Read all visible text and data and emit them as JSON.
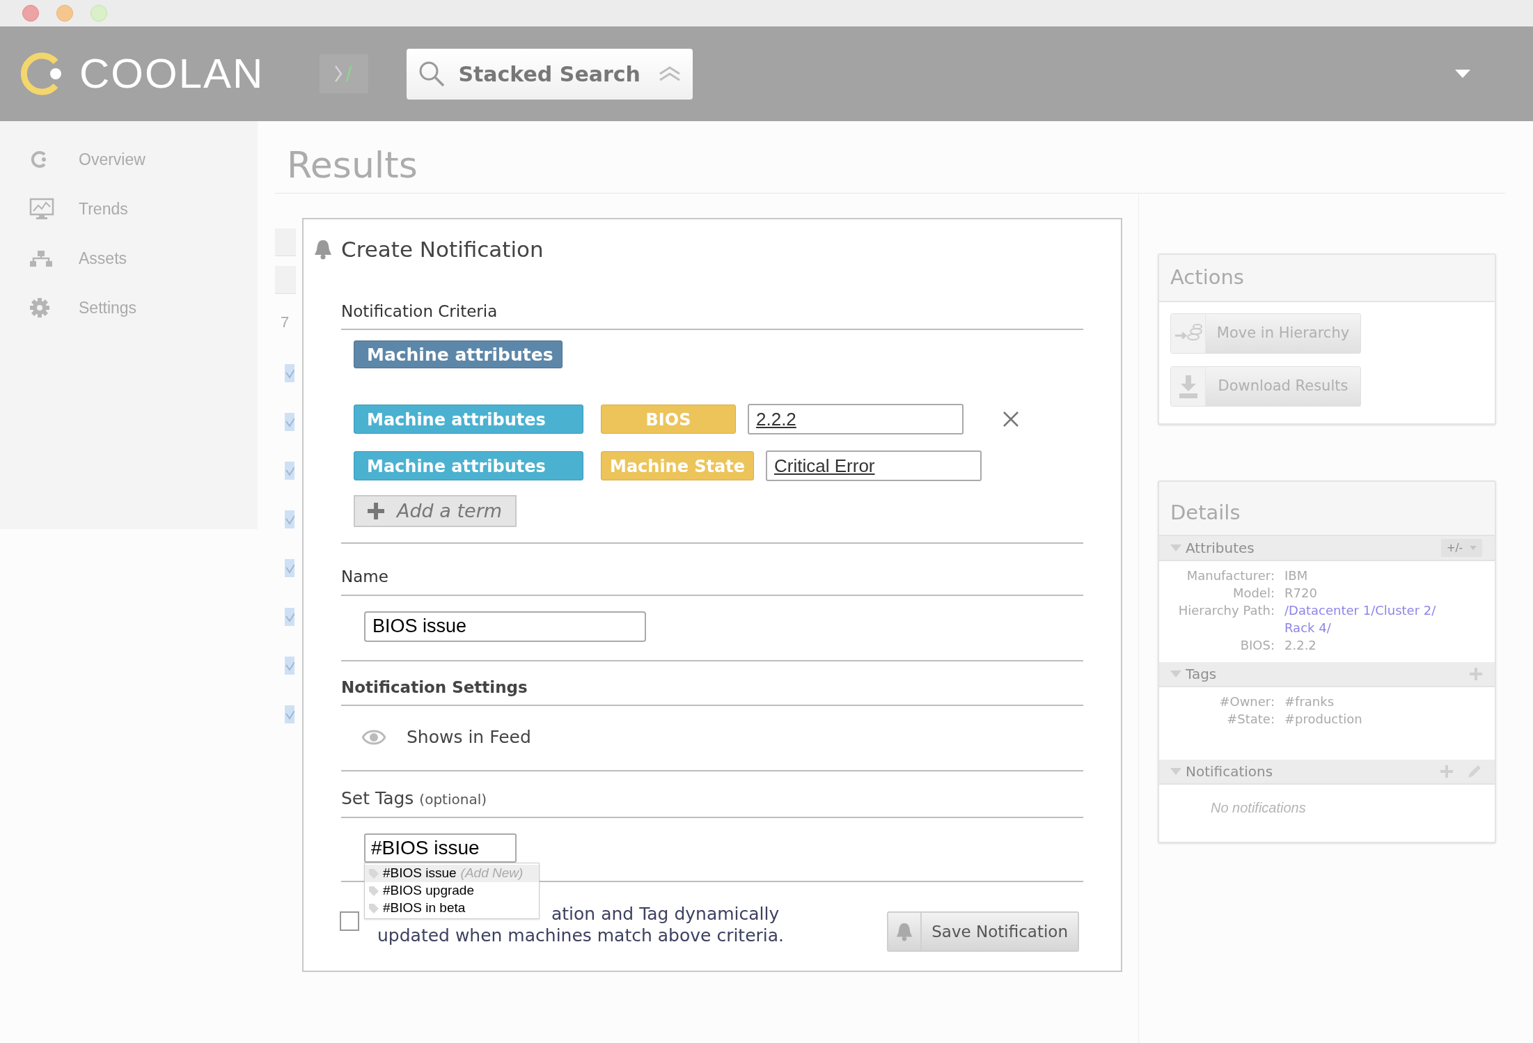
{
  "header": {
    "logo": "COOLAN",
    "search": {
      "placeholder": "Stacked Search"
    }
  },
  "sidebar": {
    "items": [
      {
        "label": "Overview",
        "kind": "overview"
      },
      {
        "label": "Trends",
        "kind": "trends"
      },
      {
        "label": "Assets",
        "kind": "assets"
      },
      {
        "label": "Settings",
        "kind": "settings"
      }
    ]
  },
  "page": {
    "title": "Results",
    "results_count": "7"
  },
  "dialog": {
    "title": "Create Notification",
    "criteria": {
      "heading": "Notification Criteria",
      "root": "Machine attributes",
      "terms": [
        {
          "category": "Machine attributes",
          "attribute": "BIOS",
          "value": "2.2.2",
          "removable": true
        },
        {
          "category": "Machine attributes",
          "attribute": "Machine State",
          "value": "Critical Error",
          "removable": false
        }
      ],
      "add_term": "Add a term"
    },
    "name": {
      "heading": "Name",
      "value": "BIOS issue"
    },
    "settings": {
      "heading": "Notification Settings",
      "items": [
        {
          "label": "Shows in Feed"
        }
      ]
    },
    "tags": {
      "heading": "Set Tags",
      "hint": "(optional)",
      "value": "#BIOS issue",
      "suggestions": [
        {
          "label": "#BIOS issue",
          "note": "(Add New)",
          "selected": true
        },
        {
          "label": "#BIOS upgrade",
          "selected": false
        },
        {
          "label": "#BIOS in beta",
          "selected": false
        }
      ]
    },
    "dynamic": {
      "checked": false,
      "lines": [
        "ation and Tag dynamically",
        "updated when machines match above criteria."
      ]
    },
    "save": "Save Notification"
  },
  "actions": {
    "title": "Actions",
    "buttons": [
      {
        "label": "Move in Hierarchy",
        "kind": "move"
      },
      {
        "label": "Download Results",
        "kind": "download"
      }
    ]
  },
  "details": {
    "title": "Details",
    "sections": [
      {
        "title": "Attributes",
        "expanded": true,
        "control": "+/-",
        "rows": [
          {
            "label": "Manufacturer:",
            "lines": [
              "IBM"
            ],
            "kind": "text"
          },
          {
            "label": "Model:",
            "lines": [
              "R720"
            ],
            "kind": "text"
          },
          {
            "label": "Hierarchy Path:",
            "lines": [
              "/Datacenter 1/Cluster 2/",
              "Rack 4/"
            ],
            "kind": "link"
          },
          {
            "label": "BIOS:",
            "lines": [
              "2.2.2"
            ],
            "kind": "text"
          }
        ]
      },
      {
        "title": "Tags",
        "expanded": true,
        "add": true,
        "rows": [
          {
            "label": "#Owner:",
            "lines": [
              "#franks"
            ],
            "kind": "text"
          },
          {
            "label": "#State:",
            "lines": [
              "#production"
            ],
            "kind": "text"
          }
        ]
      },
      {
        "title": "Notifications",
        "expanded": true,
        "add": true,
        "edit": true,
        "empty": "No notifications"
      }
    ]
  }
}
